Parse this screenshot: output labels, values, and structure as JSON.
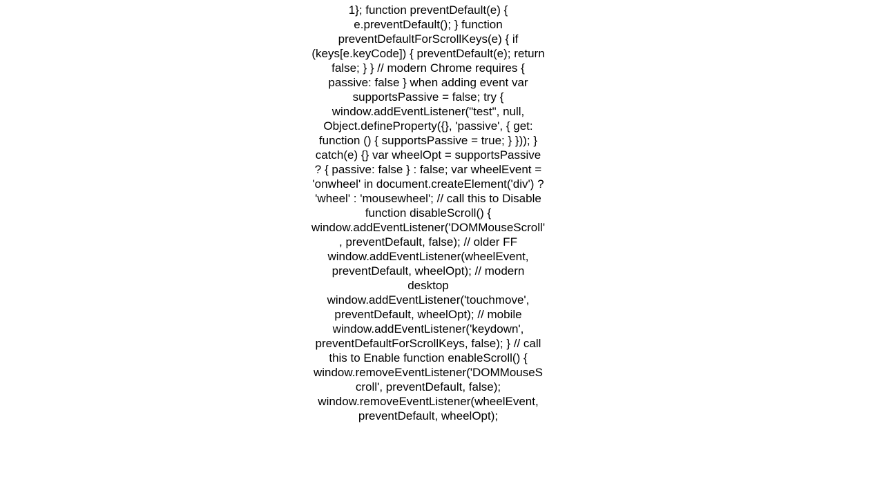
{
  "code_text": "1};  function preventDefault(e) {   e.preventDefault(); }  function preventDefaultForScrollKeys(e) {   if (keys[e.keyCode]) {     preventDefault(e);     return false;   } }  // modern Chrome requires { passive: false } when adding event var supportsPassive = false; try {   window.addEventListener(\"test\", null, Object.defineProperty({}, 'passive', {     get: function () { supportsPassive = true; }    })); } catch(e) {}  var wheelOpt = supportsPassive ? { passive: false } : false; var wheelEvent = 'onwheel' in document.createElement('div') ? 'wheel' : 'mousewheel';  // call this to Disable function disableScroll() {   window.addEventListener('DOMMouseScroll', preventDefault, false); // older FF   window.addEventListener(wheelEvent, preventDefault, wheelOpt); // modern desktop   window.addEventListener('touchmove', preventDefault, wheelOpt); // mobile   window.addEventListener('keydown', preventDefaultForScrollKeys, false); }  // call this to Enable function enableScroll() {   window.removeEventListener('DOMMouseScroll', preventDefault, false);   window.removeEventListener(wheelEvent, preventDefault, wheelOpt);"
}
